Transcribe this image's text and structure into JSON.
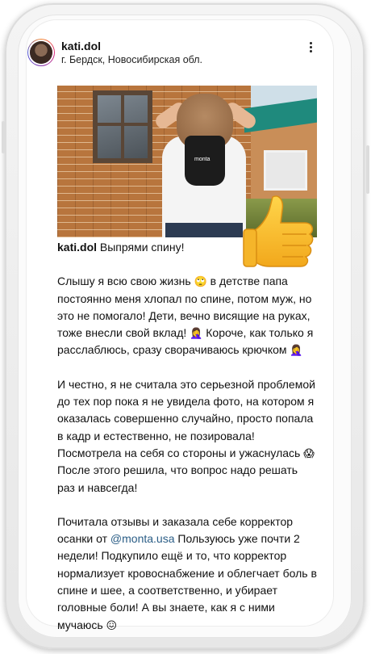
{
  "post": {
    "username": "kati.dol",
    "location": "г. Бердск, Новосибирская обл.",
    "menu_icon": "more-vertical-icon",
    "photo": {
      "description_icon": "photo",
      "logo_text": "monta"
    },
    "sticker": "thumbs-up-emoji",
    "caption": {
      "username": "kati.dol",
      "lead": "Выпрями спину!",
      "p1_a": "Слышу я всю свою жизнь",
      "p1_emoji1": "🙄",
      "p1_b": "в детстве папа постоянно меня хлопал по спине, потом муж, но это не помогало! Дети, вечно висящие на руках, тоже внесли свой вклад!",
      "p1_emoji2": "🤦‍♀️",
      "p1_c": "Короче, как только я расслаблюсь, сразу сворачиваюсь крючком",
      "p1_emoji3": "🤦‍♀️",
      "p2_a": "И честно, я не считала это серьезной проблемой до тех пор пока я не увидела фото, на котором я оказалась совершенно случайно, просто попала в кадр и естественно, не позировала! Посмотрела на себя со стороны и ужаснулась",
      "p2_emoji": "😱",
      "p2_b": "После этого решила, что вопрос надо решать раз и навсегда!",
      "p3_a": "Почитала отзывы и заказала себе корректор осанки от",
      "p3_mention": "@monta.usa",
      "p3_b": "Пользуюсь уже почти 2 недели! Подкупило ещё и то, что корректор нормализует кровоснабжение и облегчает боль в спине и шее, а соответственно, и убирает головные боли! А вы знаете, как я с ними мучаюсь",
      "p3_emoji": "😖"
    }
  },
  "colors": {
    "mention": "#2a5d86",
    "phone_frame": "#e9e9e9"
  }
}
